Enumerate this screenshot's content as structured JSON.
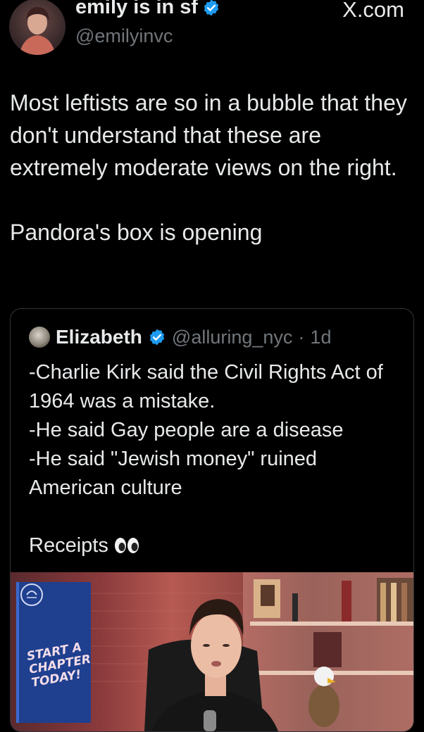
{
  "author": {
    "display_name": "emily is in sf",
    "handle": "@emilyinvc",
    "verified": true
  },
  "source_label": "X.com",
  "tweet": {
    "paragraphs": [
      "Most leftists are so in a bubble that they don't understand that these are extremely moderate views on the right.",
      "Pandora's box is opening"
    ]
  },
  "quoted_tweet": {
    "display_name": "Elizabeth",
    "handle": "@alluring_nyc",
    "separator": "·",
    "time": "1d",
    "lines": [
      "-Charlie Kirk said the Civil Rights Act of 1964 was a mistake.",
      "-He said Gay people are a disease",
      "-He said \"Jewish money\" ruined American culture"
    ],
    "receipts_text": "Receipts",
    "receipts_emoji": "eyes-emoji",
    "media": {
      "banner_text": "START A\nCHAPTER\nTODAY!"
    }
  },
  "colors": {
    "background": "#000000",
    "text_primary": "#e7e9ea",
    "text_secondary": "#71767b",
    "verified_badge": "#1d9bf0",
    "border": "#2f3336"
  }
}
